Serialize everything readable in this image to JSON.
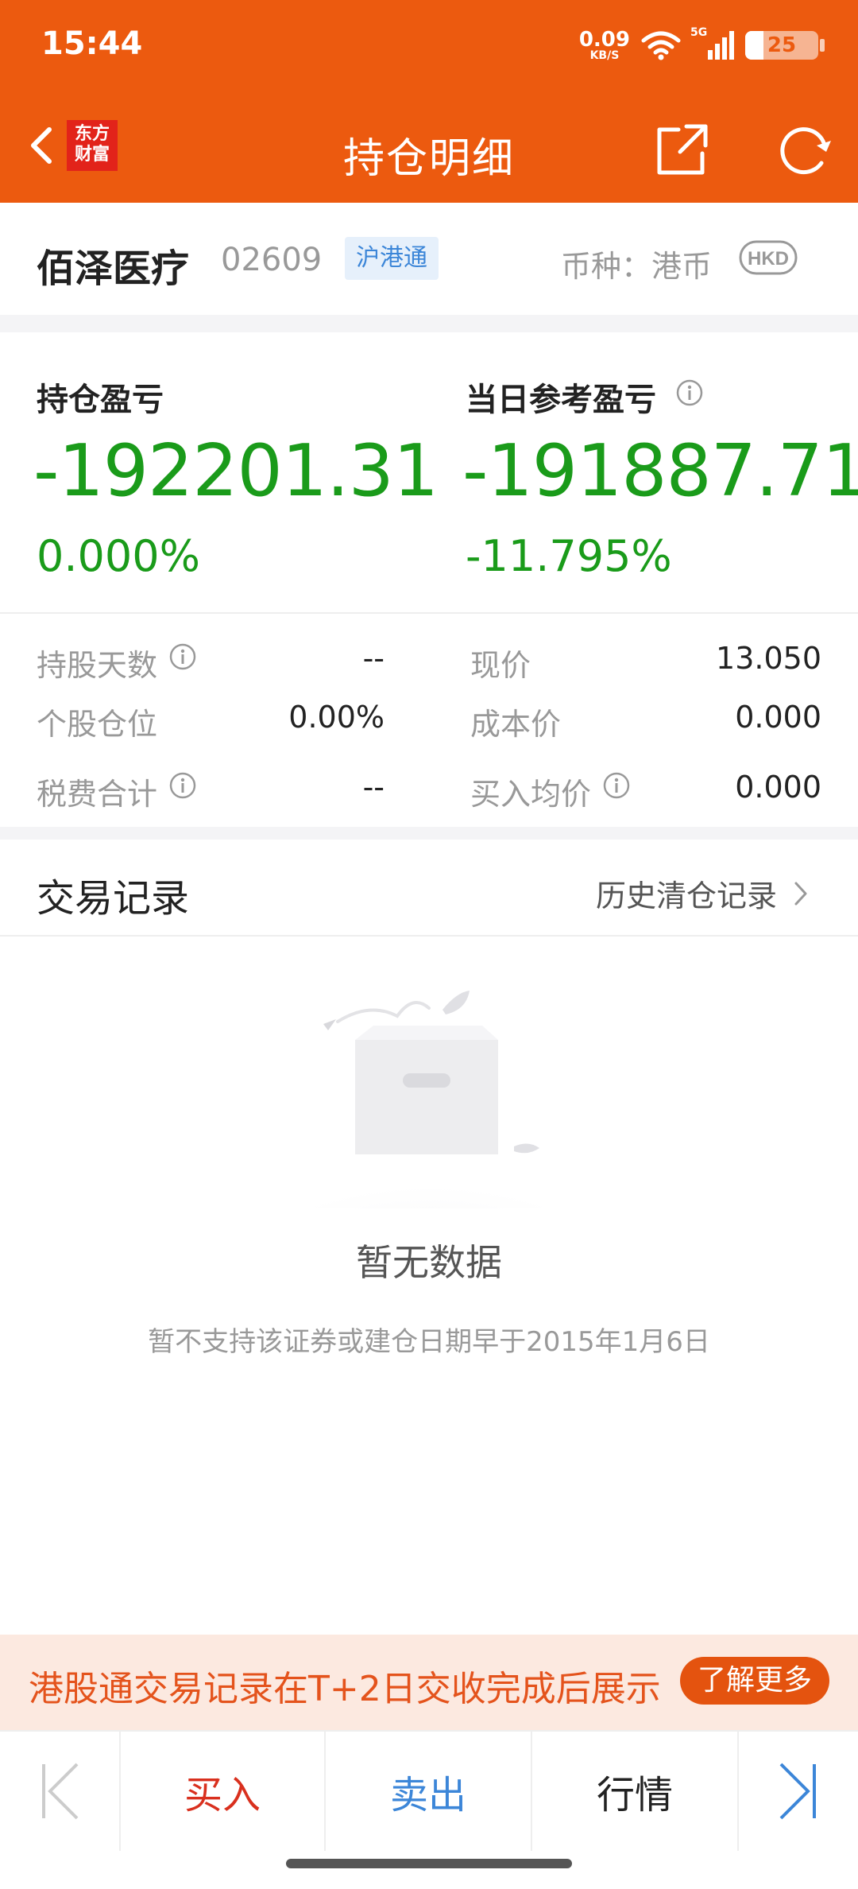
{
  "status_bar": {
    "time": "15:44",
    "net_speed_value": "0.09",
    "net_speed_unit": "KB/S",
    "signal_label": "5G",
    "battery": "25",
    "battery_level": 0.25
  },
  "header": {
    "title": "持仓明细",
    "logo_line1": "东方",
    "logo_line2": "财富",
    "back_icon": "chevron-left-icon",
    "share_icon": "share-icon",
    "refresh_icon": "refresh-icon"
  },
  "stock": {
    "name": "佰泽医疗",
    "code": "02609",
    "badge": "沪港通",
    "currency_label": "币种：港币",
    "currency_icon": "HKD"
  },
  "pnl": {
    "position_label": "持仓盈亏",
    "position_value": "-192201.31",
    "position_pct": "0.000%",
    "daily_label": "当日参考盈亏",
    "daily_value": "-191887.71",
    "daily_pct": "-11.795%"
  },
  "details": {
    "holding_days_label": "持股天数",
    "holding_days_value": "--",
    "current_price_label": "现价",
    "current_price_value": "13.050",
    "position_ratio_label": "个股仓位",
    "position_ratio_value": "0.00%",
    "cost_price_label": "成本价",
    "cost_price_value": "0.000",
    "tax_label": "税费合计",
    "tax_value": "--",
    "avg_buy_label": "买入均价",
    "avg_buy_value": "0.000"
  },
  "records": {
    "title": "交易记录",
    "history_link": "历史清仓记录",
    "empty_title": "暂无数据",
    "empty_sub": "暂不支持该证券或建仓日期早于2015年1月6日"
  },
  "notice": {
    "text": "港股通交易记录在T+2日交收完成后展示",
    "button": "了解更多"
  },
  "toolbar": {
    "buy": "买入",
    "sell": "卖出",
    "quote": "行情"
  },
  "colors": {
    "brand": "#EC5A0F",
    "loss_green": "#1A9B1A",
    "buy_red": "#D9301E",
    "sell_blue": "#3C86D8"
  }
}
